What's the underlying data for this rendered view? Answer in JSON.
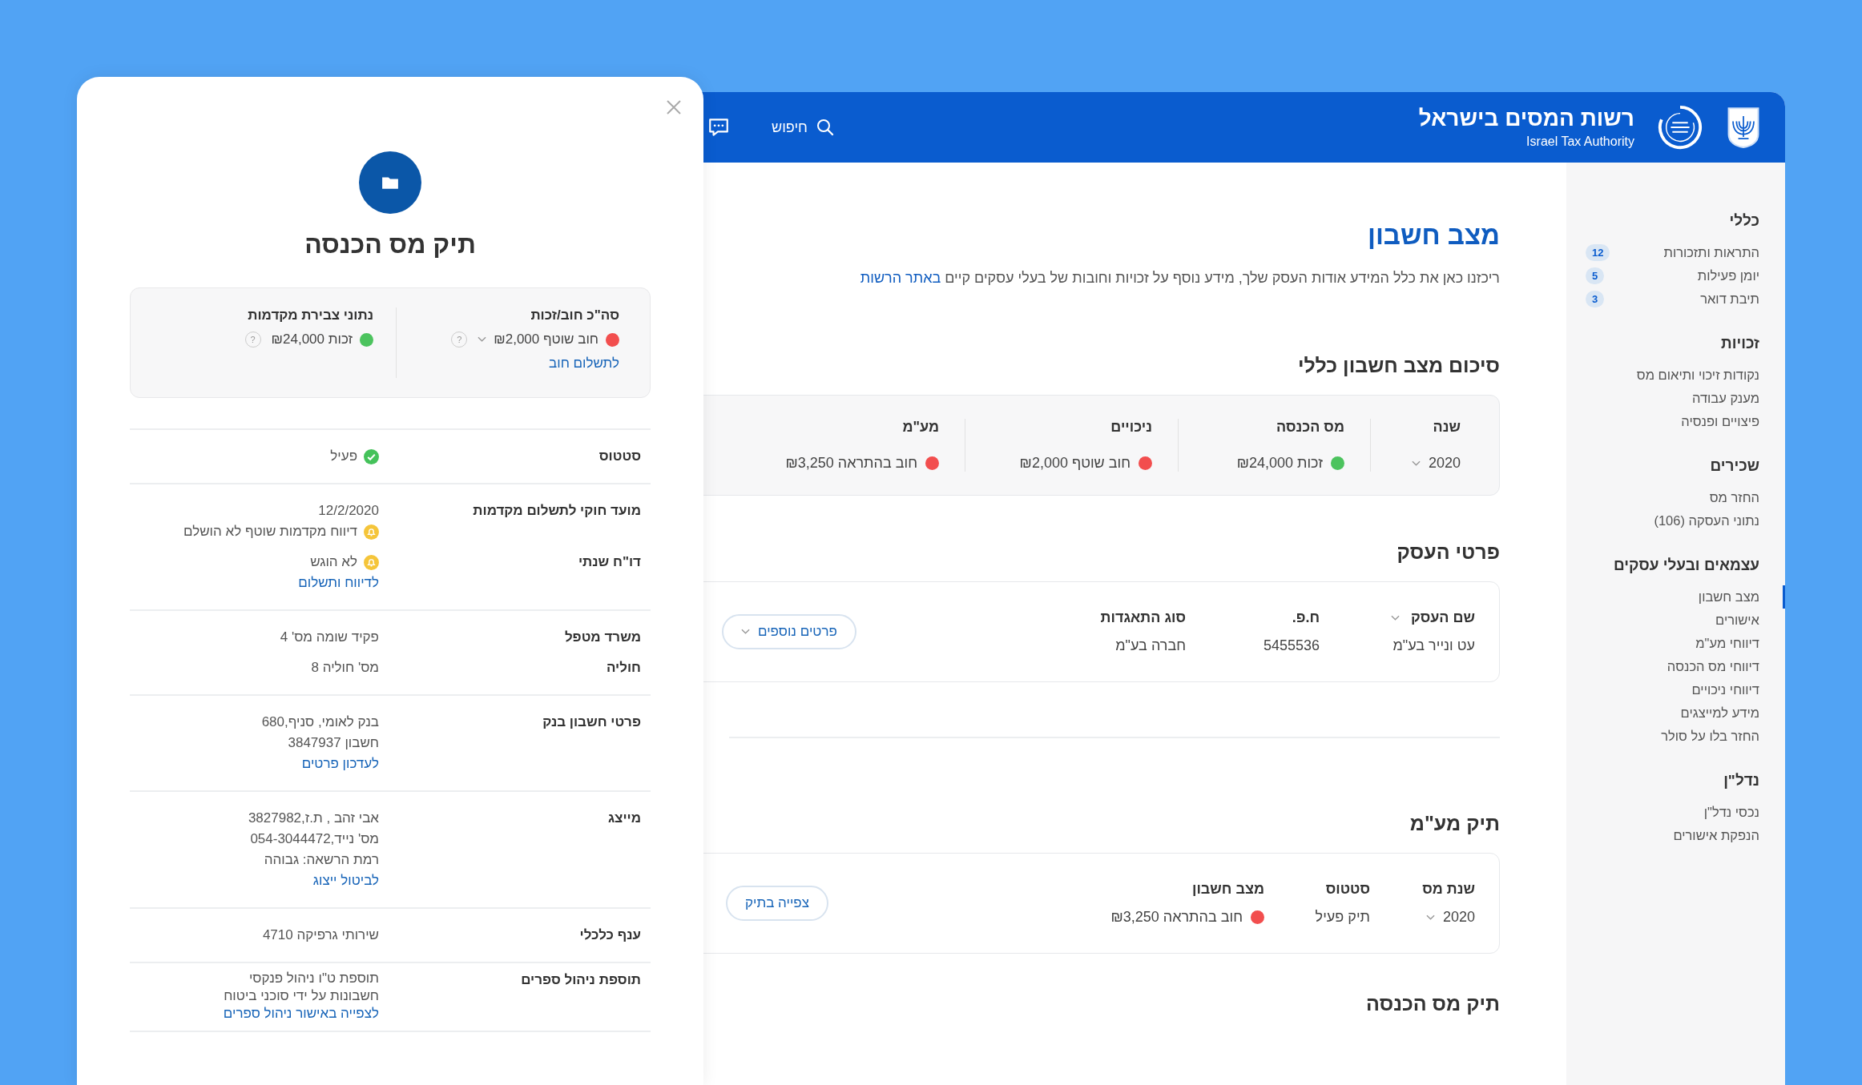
{
  "header": {
    "title": "רשות המסים בישראל",
    "subtitle": "Israel Tax Authority",
    "search_label": "חיפוש"
  },
  "sidebar": [
    {
      "title": "כללי",
      "items": [
        {
          "label": "התראות ותזכורות",
          "badge": "12",
          "selected": false
        },
        {
          "label": "יומן פעילות",
          "badge": "5",
          "selected": false
        },
        {
          "label": "תיבת דואר",
          "badge": "3",
          "selected": false
        }
      ]
    },
    {
      "title": "זכויות",
      "items": [
        {
          "label": "נקודות זיכוי ותיאום מס",
          "selected": false
        },
        {
          "label": "מענק עבודה",
          "selected": false
        },
        {
          "label": "פיצויים ופנסיה",
          "selected": false
        }
      ]
    },
    {
      "title": "שכירים",
      "items": [
        {
          "label": "החזר מס",
          "selected": false
        },
        {
          "label": "נתוני העסקה (106)",
          "selected": false
        }
      ]
    },
    {
      "title": "עצמאים ובעלי עסקים",
      "items": [
        {
          "label": "מצב חשבון",
          "selected": true
        },
        {
          "label": "אישורים",
          "selected": false
        },
        {
          "label": "דיווחי מע\"מ",
          "selected": false
        },
        {
          "label": "דיווחי מס הכנסה",
          "selected": false
        },
        {
          "label": "דיווחי ניכויים",
          "selected": false
        },
        {
          "label": "מידע למייצגים",
          "selected": false
        },
        {
          "label": "החזר בלו על סולר",
          "selected": false
        }
      ]
    },
    {
      "title": "נדל\"ן",
      "items": [
        {
          "label": "נכסי נדל\"ן",
          "selected": false
        },
        {
          "label": "הנפקת אישורים",
          "selected": false
        }
      ]
    }
  ],
  "page": {
    "title": "מצב חשבון",
    "intro": "ריכזנו כאן את כלל המידע אודות העסק שלך, מידע נוסף על זכויות וחובות של בעלי עסקים קיים",
    "intro_link": "באתר הרשות"
  },
  "summary": {
    "title": "סיכום מצב חשבון כללי",
    "columns": [
      {
        "label": "שנה",
        "value": "2020",
        "kind": "dropdown"
      },
      {
        "label": "מס הכנסה",
        "value": "זכות ₪24,000",
        "kind": "status",
        "color": "#4cc35e"
      },
      {
        "label": "ניכויים",
        "value": "חוב שוטף ₪2,000",
        "kind": "status",
        "color": "#f24e4e"
      },
      {
        "label": "מע\"מ",
        "value": "חוב בהתראה ₪3,250",
        "kind": "status",
        "color": "#f24e4e"
      }
    ]
  },
  "business": {
    "title": "פרטי העסק",
    "columns": [
      {
        "label": "שם העסק",
        "value": "עט ונייר בע\"מ",
        "kind": "sortable"
      },
      {
        "label": "ח.פ.",
        "value": "5455536",
        "kind": "plain"
      },
      {
        "label": "סוג התאגדות",
        "value": "חברה בע\"מ",
        "kind": "plain"
      }
    ],
    "button": "פרטים נוספים"
  },
  "vat": {
    "title": "תיק מע\"מ",
    "columns": [
      {
        "label": "שנת מס",
        "value": "2020",
        "kind": "dropdown"
      },
      {
        "label": "סטטוס",
        "value": "תיק פעיל",
        "kind": "plain"
      },
      {
        "label": "מצב חשבון",
        "value": "חוב בהתראה ₪3,250",
        "kind": "status",
        "color": "#f24e4e"
      }
    ],
    "button": "צפייה בתיק"
  },
  "income_heading": "תיק מס הכנסה",
  "panel": {
    "title": "תיק מס הכנסה",
    "summary": [
      {
        "label": "סה\"כ חוב/זכות",
        "value": "חוב שוטף ₪2,000",
        "color": "#f24e4e",
        "dropdown": true,
        "help": "?",
        "link": "לתשלום חוב"
      },
      {
        "label": "נתוני צבירת מקדמות",
        "value": "זכות ₪24,000",
        "color": "#4cc35e",
        "dropdown": false,
        "help": "?"
      }
    ],
    "groups": [
      {
        "rows": [
          {
            "label": "סטטוס",
            "lines": [
              {
                "kind": "status",
                "text": "פעיל"
              }
            ]
          }
        ]
      },
      {
        "rows": [
          {
            "label": "מועד חוקי לתשלום מקדמות",
            "lines": [
              {
                "kind": "text",
                "text": "12/2/2020"
              },
              {
                "kind": "alert",
                "text": "דיווח מקדמות שוטף לא הושלם"
              }
            ]
          },
          {
            "label": "דו\"ח שנתי",
            "lines": [
              {
                "kind": "alert",
                "text": "לא הוגש"
              },
              {
                "kind": "link",
                "text": "לדיווח ותשלום"
              }
            ]
          }
        ]
      },
      {
        "rows": [
          {
            "label": "משרד מטפל",
            "lines": [
              {
                "kind": "text",
                "text": "פקיד שומה מס' 4"
              }
            ]
          },
          {
            "label": "חוליה",
            "lines": [
              {
                "kind": "text",
                "text": "מס' חוליה 8"
              }
            ]
          }
        ]
      },
      {
        "rows": [
          {
            "label": "פרטי חשבון בנק",
            "lines": [
              {
                "kind": "text",
                "text": "בנק לאומי, סניף,680"
              },
              {
                "kind": "text",
                "text": "חשבון 3847937"
              },
              {
                "kind": "link",
                "text": "לעדכון פרטים"
              }
            ]
          }
        ]
      },
      {
        "rows": [
          {
            "label": "מייצג",
            "lines": [
              {
                "kind": "text",
                "text": "אבי זהב , ת.ז,3827982"
              },
              {
                "kind": "text",
                "text": "מס' נייד,054-3044472"
              },
              {
                "kind": "text",
                "text": "רמת הרשאה: גבוהה"
              },
              {
                "kind": "link",
                "text": "לביטול ייצוג"
              }
            ]
          }
        ]
      },
      {
        "rows": [
          {
            "label": "ענף כלכלי",
            "lines": [
              {
                "kind": "text",
                "text": "שירותי גרפיקה 4710"
              }
            ]
          }
        ]
      },
      {
        "rows": [
          {
            "label": "תוספת ניהול ספרים",
            "lines": [
              {
                "kind": "tight",
                "text": "תוספת ט\"ו ניהול פנקסי"
              },
              {
                "kind": "tight",
                "text": "חשבונות  על ידי סוכני ביטוח"
              },
              {
                "kind": "tightlink",
                "text": "לצפייה באישור ניהול ספרים"
              }
            ]
          }
        ]
      }
    ]
  }
}
